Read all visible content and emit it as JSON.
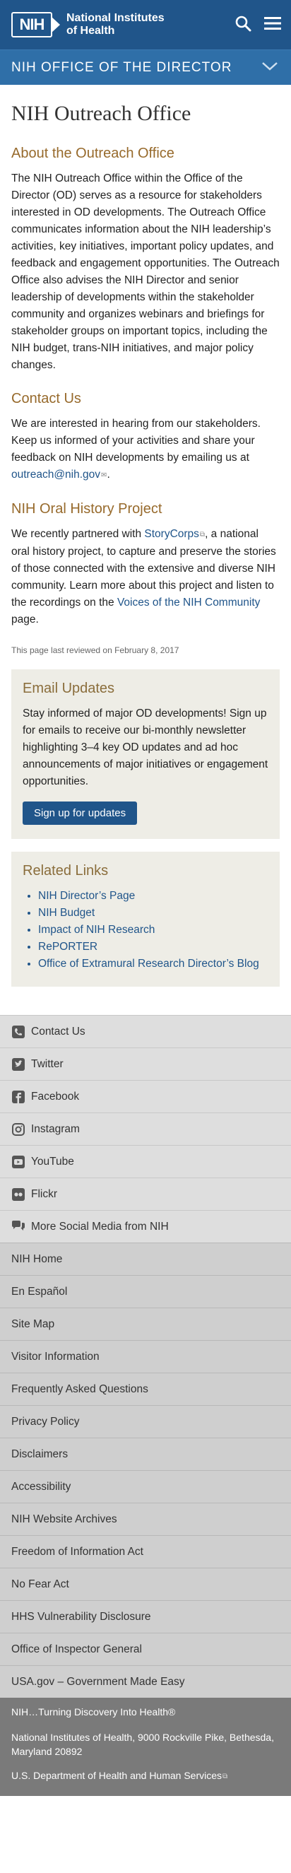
{
  "header": {
    "logo_abbr": "NIH",
    "logo_line1": "National Institutes",
    "logo_line2": "of Health",
    "section_title": "NIH OFFICE OF THE DIRECTOR"
  },
  "page": {
    "title": "NIH Outreach Office",
    "about_heading": "About the Outreach Office",
    "about_text": "The NIH Outreach Office within the Office of the Director (OD) serves as a resource for stakeholders interested in OD developments. The Outreach Office communicates information about the NIH leadership’s activities, key initiatives, important policy updates, and feedback and engagement opportunities. The Outreach Office also advises the NIH Director and senior leadership of developments within the stakeholder community and organizes webinars and briefings for stakeholder groups on important topics, including the NIH budget, trans-NIH initiatives, and major policy changes.",
    "contact_heading": "Contact Us",
    "contact_text": "We are interested in hearing from our stakeholders. Keep us informed of your activities and share your feedback on NIH developments by emailing us at",
    "contact_email": "outreach@nih.gov",
    "oral_heading": "NIH Oral History Project",
    "oral_text_1": "We recently partnered with",
    "oral_link_storycorps": "StoryCorps",
    "oral_text_2": ", a national oral history project, to capture and preserve the stories of those connected with the extensive and diverse NIH community. Learn more about this project and listen to the recordings on the",
    "oral_link_voices": "Voices of the NIH Community",
    "oral_text_3": "page.",
    "reviewed": "This page last reviewed on February 8, 2017"
  },
  "email_updates": {
    "heading": "Email Updates",
    "text": "Stay informed of major OD developments! Sign up for emails to receive our bi-monthly newsletter highlighting 3–4 key OD updates and ad hoc announcements of major initiatives or engagement opportunities.",
    "button": "Sign up for updates"
  },
  "related_links": {
    "heading": "Related Links",
    "items": [
      "NIH Director’s Page",
      "NIH Budget",
      "Impact of NIH Research",
      "RePORTER",
      "Office of Extramural Research Director’s Blog"
    ]
  },
  "footer": {
    "social": [
      {
        "label": "Contact Us",
        "icon": "phone-icon"
      },
      {
        "label": "Twitter",
        "icon": "twitter-icon"
      },
      {
        "label": "Facebook",
        "icon": "facebook-icon"
      },
      {
        "label": "Instagram",
        "icon": "instagram-icon"
      },
      {
        "label": "YouTube",
        "icon": "youtube-icon"
      },
      {
        "label": "Flickr",
        "icon": "flickr-icon"
      },
      {
        "label": "More Social Media from NIH",
        "icon": "chat-icon"
      }
    ],
    "links_primary": [
      "NIH Home",
      "En Español"
    ],
    "links": [
      "Site Map",
      "Visitor Information",
      "Frequently Asked Questions",
      "Privacy Policy",
      "Disclaimers",
      "Accessibility",
      "NIH Website Archives",
      "Freedom of Information Act",
      "No Fear Act",
      "HHS Vulnerability Disclosure",
      "Office of Inspector General",
      "USA.gov – Government Made Easy"
    ],
    "tagline": "NIH…Turning Discovery Into Health®",
    "address": "National Institutes of Health, 9000 Rockville Pike, Bethesda, Maryland 20892",
    "hhs": "U.S. Department of Health and Human Services"
  },
  "colors": {
    "brand_blue": "#20558a",
    "subbar_blue": "#2f6fa8",
    "heading_gold": "#8a6d3b",
    "box_bg": "#eeede6",
    "footer_gray": "#7a7a7a"
  }
}
